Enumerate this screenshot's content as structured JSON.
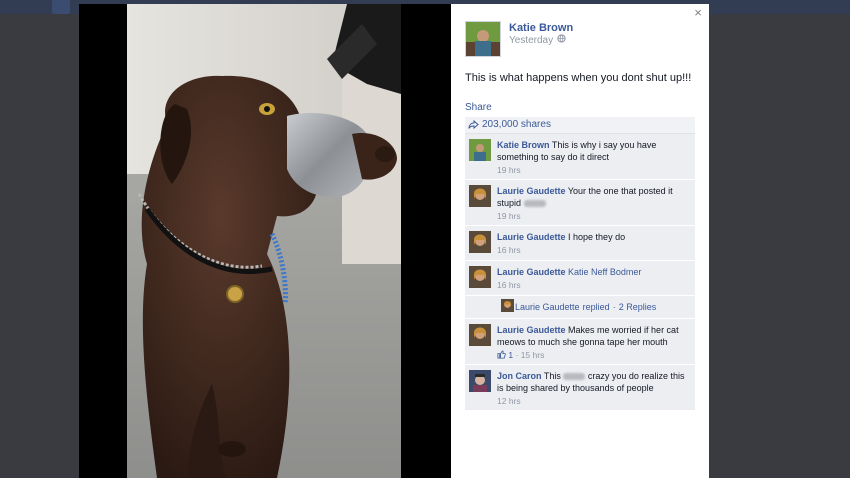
{
  "post": {
    "author": "Katie Brown",
    "time": "Yesterday",
    "text": "This is what happens when you dont shut up!!!",
    "share_label": "Share",
    "shares": "203,000 shares"
  },
  "close_label": "×",
  "comments": [
    {
      "name": "Katie Brown",
      "text": "This is why i say you have something to say do it direct",
      "time": "19 hrs"
    },
    {
      "name": "Laurie Gaudette",
      "text": "Your the one that posted it stupid",
      "time": "19 hrs"
    },
    {
      "name": "Laurie Gaudette",
      "text": "I hope they do",
      "time": "16 hrs"
    },
    {
      "name": "Laurie Gaudette",
      "text": "Katie Neff Bodmer",
      "time": "16 hrs"
    },
    {
      "name": "Laurie Gaudette",
      "text": "Makes me worried if her cat meows to much she gonna tape her mouth",
      "likes": "1",
      "time": "15 hrs"
    },
    {
      "name": "Jon Caron",
      "text_before": "This",
      "text_after": "crazy you do realize this is being shared by thousands of people",
      "time": "12 hrs"
    }
  ],
  "reply": {
    "name": "Laurie Gaudette",
    "action": "replied",
    "count": "2 Replies"
  },
  "colors": {
    "link": "#3b5998",
    "meta": "#9197a3",
    "comment_bg": "#eceef2"
  }
}
